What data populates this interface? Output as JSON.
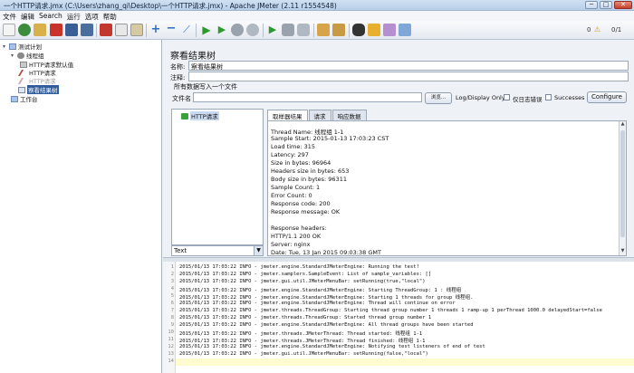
{
  "window": {
    "title": "一个HTTP请求.jmx (C:\\Users\\zhang_qi\\Desktop\\一个HTTP请求.jmx) - Apache JMeter (2.11 r1554548)",
    "buttons": [
      "─",
      "□",
      "✕"
    ]
  },
  "menu": [
    "文件",
    "编辑",
    "Search",
    "运行",
    "选项",
    "帮助"
  ],
  "toolbar": {
    "warnings": "0",
    "threads": "0/1"
  },
  "tree": [
    {
      "label": "测试计划",
      "level": 0,
      "icon": "test-plan-icon"
    },
    {
      "label": "线程组",
      "level": 1,
      "icon": "thread-group-icon"
    },
    {
      "label": "HTTP请求默认值",
      "level": 2,
      "icon": "config-icon"
    },
    {
      "label": "HTTP请求",
      "level": 2,
      "icon": "sampler-icon"
    },
    {
      "label": "HTTP请求",
      "level": 2,
      "icon": "sampler-disabled-icon"
    },
    {
      "label": "察看结果树",
      "level": 1,
      "icon": "listener-icon",
      "selected": true
    },
    {
      "label": "工作台",
      "level": 0,
      "icon": "workbench-icon"
    }
  ],
  "panel": {
    "title": "察看结果树",
    "name_label": "名称:",
    "name_value": "察看结果树",
    "comment_label": "注释:",
    "comment_value": "",
    "group_title": "所有数据写入一个文件",
    "filename_label": "文件名",
    "filename_value": "",
    "browse_label": "浏览...",
    "log_display_label": "Log/Display Only:",
    "errors_label": "仅日志错误",
    "successes_label": "Successes",
    "configure_label": "Configure"
  },
  "results": {
    "items": [
      "HTTP请求"
    ],
    "renderer": "Text",
    "tabs": [
      "取样器结果",
      "请求",
      "响应数据"
    ],
    "detail_lines": [
      "Thread Name: 线程组 1-1",
      "Sample Start: 2015-01-13 17:03:23 CST",
      "Load time: 315",
      "Latency: 297",
      "Size in bytes: 96964",
      "Headers size in bytes: 653",
      "Body size in bytes: 96311",
      "Sample Count: 1",
      "Error Count: 0",
      "Response code: 200",
      "Response message: OK",
      "",
      "Response headers:",
      "HTTP/1.1 200 OK",
      "Server: nginx",
      "Date: Tue, 13 Jan 2015 09:03:38 GMT"
    ]
  },
  "log": {
    "lines": [
      "2015/01/13 17:03:22 INFO  - jmeter.engine.StandardJMeterEngine: Running the test!",
      "2015/01/13 17:03:22 INFO  - jmeter.samplers.SampleEvent: List of sample_variables: []",
      "2015/01/13 17:03:22 INFO  - jmeter.gui.util.JMeterMenuBar: setRunning(true,\"local\")",
      "2015/01/13 17:03:22 INFO  - jmeter.engine.StandardJMeterEngine: Starting ThreadGroup: 1 : 线程组",
      "2015/01/13 17:03:22 INFO  - jmeter.engine.StandardJMeterEngine: Starting 1 threads for group 线程组.",
      "2015/01/13 17:03:22 INFO  - jmeter.engine.StandardJMeterEngine: Thread will continue on error",
      "2015/01/13 17:03:22 INFO  - jmeter.threads.ThreadGroup: Starting thread group number 1 threads 1 ramp-up 1 perThread 1000.0 delayedStart=false",
      "2015/01/13 17:03:22 INFO  - jmeter.threads.ThreadGroup: Started thread group number 1",
      "2015/01/13 17:03:22 INFO  - jmeter.engine.StandardJMeterEngine: All thread groups have been started",
      "2015/01/13 17:03:22 INFO  - jmeter.threads.JMeterThread: Thread started: 线程组 1-1",
      "2015/01/13 17:03:22 INFO  - jmeter.threads.JMeterThread: Thread finished: 线程组 1-1",
      "2015/01/13 17:03:22 INFO  - jmeter.engine.StandardJMeterEngine: Notifying test listeners of end of test",
      "2015/01/13 17:03:22 INFO  - jmeter.gui.util.JMeterMenuBar: setRunning(false,\"local\")",
      ""
    ],
    "line_numbers": [
      "1",
      "2",
      "3",
      "4",
      "5",
      "6",
      "7",
      "8",
      "9",
      "10",
      "11",
      "12",
      "13",
      "14"
    ]
  },
  "colors": {
    "selection": "#2f5c9a",
    "warning": "#e0a000"
  }
}
